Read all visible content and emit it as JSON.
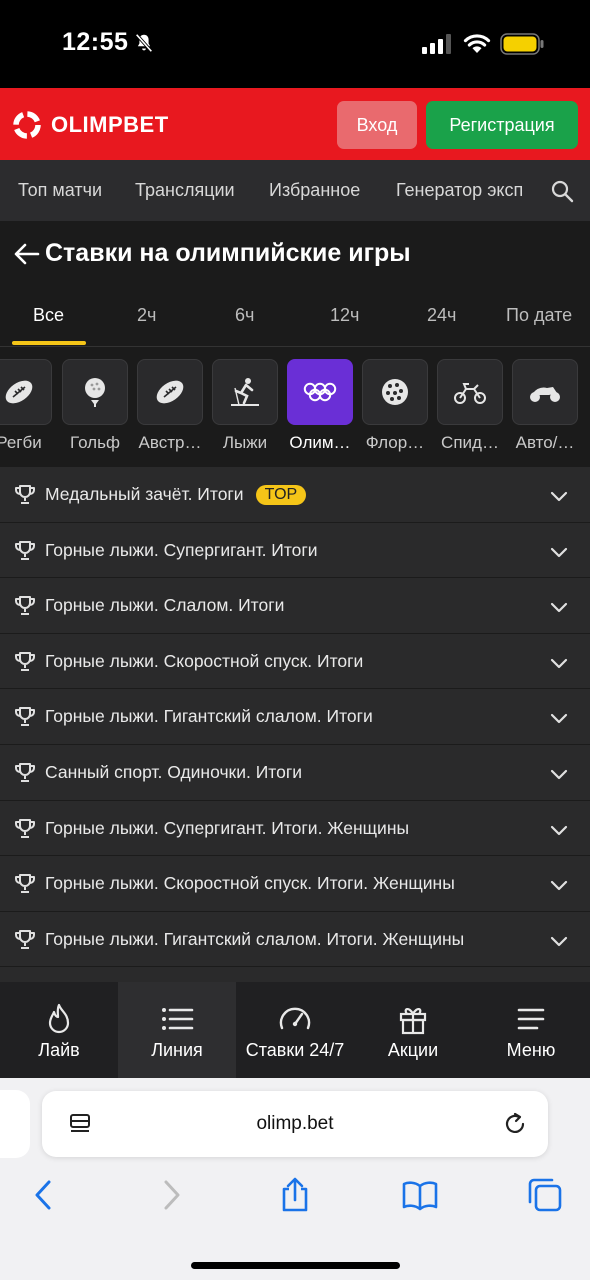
{
  "status": {
    "time": "12:55"
  },
  "header": {
    "logo_text": "OLIMPBET",
    "login_label": "Вход",
    "register_label": "Регистрация"
  },
  "top_nav": {
    "items": [
      "Топ матчи",
      "Трансляции",
      "Избранное",
      "Генератор эксп"
    ]
  },
  "page": {
    "title": "Ставки на олимпийские игры"
  },
  "time_tabs": [
    "Все",
    "2ч",
    "6ч",
    "12ч",
    "24ч",
    "По дате"
  ],
  "sports": [
    {
      "label": "Регби",
      "icon": "rugby-ball-icon"
    },
    {
      "label": "Гольф",
      "icon": "golf-ball-icon"
    },
    {
      "label": "Австр…",
      "icon": "aussie-rules-ball-icon"
    },
    {
      "label": "Лыжи",
      "icon": "skier-icon"
    },
    {
      "label": "Олим…",
      "icon": "olympic-rings-icon"
    },
    {
      "label": "Флор…",
      "icon": "floorball-icon"
    },
    {
      "label": "Спид…",
      "icon": "speedway-bike-icon"
    },
    {
      "label": "Авто/…",
      "icon": "motorbike-icon"
    }
  ],
  "tournaments": [
    {
      "title": "Медальный зачёт. Итоги",
      "badge": "TOP"
    },
    {
      "title": "Горные лыжи. Супергигант. Итоги"
    },
    {
      "title": "Горные лыжи. Слалом. Итоги"
    },
    {
      "title": "Горные лыжи. Скоростной спуск. Итоги"
    },
    {
      "title": "Горные лыжи. Гигантский слалом. Итоги"
    },
    {
      "title": "Санный спорт. Одиночки. Итоги"
    },
    {
      "title": "Горные лыжи. Супергигант. Итоги. Женщины"
    },
    {
      "title": "Горные лыжи. Скоростной спуск. Итоги. Женщины"
    },
    {
      "title": "Горные лыжи. Гигантский слалом. Итоги. Женщины"
    }
  ],
  "app_nav": [
    {
      "label": "Лайв",
      "icon": "flame-icon"
    },
    {
      "label": "Линия",
      "icon": "list-icon"
    },
    {
      "label": "Ставки 24/7",
      "icon": "speedometer-icon"
    },
    {
      "label": "Акции",
      "icon": "gift-icon"
    },
    {
      "label": "Меню",
      "icon": "menu-icon"
    }
  ],
  "browser": {
    "url": "olimp.bet"
  },
  "colors": {
    "brand_red": "#e8181f",
    "register_green": "#1aa24a",
    "accent_yellow": "#f5c518",
    "active_sport": "#6a2fd6"
  }
}
